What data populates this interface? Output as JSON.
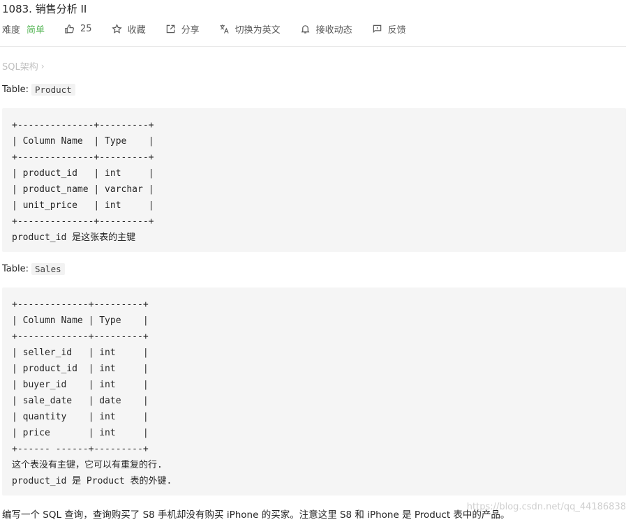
{
  "problem": {
    "title": "1083. 销售分析 II"
  },
  "meta": {
    "difficulty_label": "难度",
    "difficulty_value": "简单",
    "likes": "25",
    "favorite": "收藏",
    "share": "分享",
    "switch_language": "切换为英文",
    "subscribe": "接收动态",
    "feedback": "反馈"
  },
  "breadcrumb": {
    "label": "SQL架构",
    "chevron": "›"
  },
  "tables": [
    {
      "prefix": "Table:",
      "name": "Product",
      "lines": [
        "+--------------+---------+",
        "| Column Name  | Type    |",
        "+--------------+---------+",
        "| product_id   | int     |",
        "| product_name | varchar |",
        "| unit_price   | int     |",
        "+--------------+---------+",
        "product_id 是这张表的主键"
      ]
    },
    {
      "prefix": "Table:",
      "name": "Sales",
      "lines": [
        "+-------------+---------+",
        "| Column Name | Type    |",
        "+-------------+---------+",
        "| seller_id   | int     |",
        "| product_id  | int     |",
        "| buyer_id    | int     |",
        "| sale_date   | date    |",
        "| quantity    | int     |",
        "| price       | int     |",
        "+------ ------+---------+",
        "这个表没有主键，它可以有重复的行.",
        "product_id 是 Product 表的外键."
      ]
    }
  ],
  "description": "编写一个 SQL 查询，查询购买了 S8 手机却没有购买 iPhone 的买家。注意这里 S8 和 iPhone 是 Product 表中的产品。",
  "watermark": "https://blog.csdn.net/qq_44186838",
  "colors": {
    "difficulty_easy": "#5cb85c",
    "code_background": "#f5f5f5",
    "muted_text": "#bfbfbf"
  }
}
